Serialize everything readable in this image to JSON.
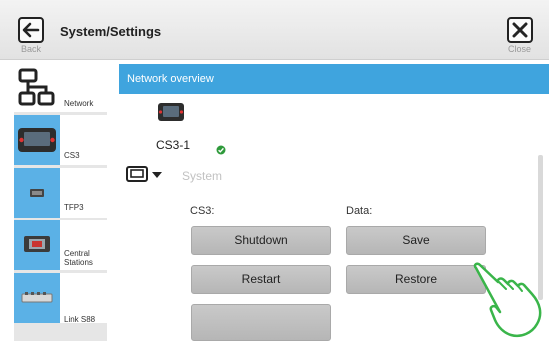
{
  "header": {
    "back_label": "Back",
    "title": "System/Settings",
    "close_label": "Close"
  },
  "sidebar": {
    "items": [
      {
        "label": "Network",
        "icon": "network-icon"
      },
      {
        "label": "CS3",
        "icon": "central-station-icon"
      },
      {
        "label": "TFP3",
        "icon": "tfp3-icon"
      },
      {
        "label": "Central\nStations",
        "icon": "central-station-icon"
      },
      {
        "label": "Link S88",
        "icon": "link-s88-icon"
      }
    ]
  },
  "main": {
    "section_title": "Network overview",
    "device": {
      "name": "CS3-1",
      "status": "ok"
    },
    "system_label": "System",
    "cs3_column_label": "CS3:",
    "data_column_label": "Data:",
    "buttons": {
      "shutdown": "Shutdown",
      "save": "Save",
      "restart": "Restart",
      "restore": "Restore"
    }
  },
  "colors": {
    "accent": "#3fa4de",
    "sidebar_selected": "#5bb1e6",
    "status_ok": "#2e9a3a",
    "hand_outline": "#3ab54a"
  }
}
